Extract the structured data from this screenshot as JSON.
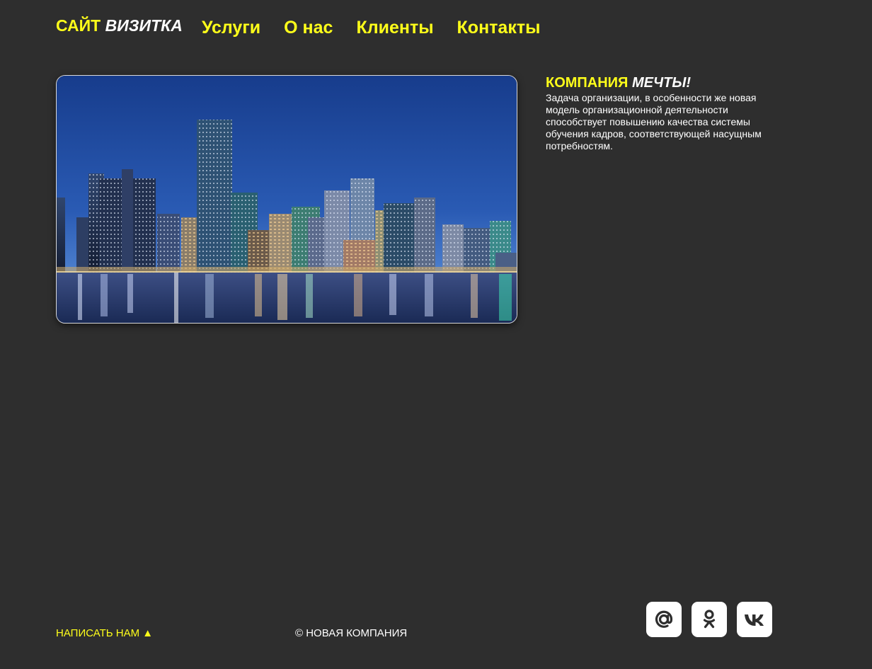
{
  "header": {
    "logo": {
      "part1": "САЙТ",
      "part2": "ВИЗИТКА"
    },
    "nav": [
      {
        "label": "Услуги"
      },
      {
        "label": "О нас"
      },
      {
        "label": "Клиенты"
      },
      {
        "label": "Контакты"
      }
    ]
  },
  "about": {
    "title_part1": "КОМПАНИЯ",
    "title_part2": "МЕЧТЫ!",
    "text": "Задача организации, в особенности же новая модель организационной деятельности способствует повышению качества системы обучения кадров, соответствующей насущным потребностям."
  },
  "footer": {
    "write_us": "НАПИСАТЬ НАМ ▲",
    "copyright": "© НОВАЯ КОМПАНИЯ",
    "socials": [
      {
        "icon": "at-sign-icon"
      },
      {
        "icon": "odnoklassniki-icon"
      },
      {
        "icon": "vk-icon"
      }
    ]
  },
  "colors": {
    "background": "#2e2e2e",
    "accent": "#ffff1a",
    "text": "#ffffff",
    "icon": "#2e2e2e"
  }
}
